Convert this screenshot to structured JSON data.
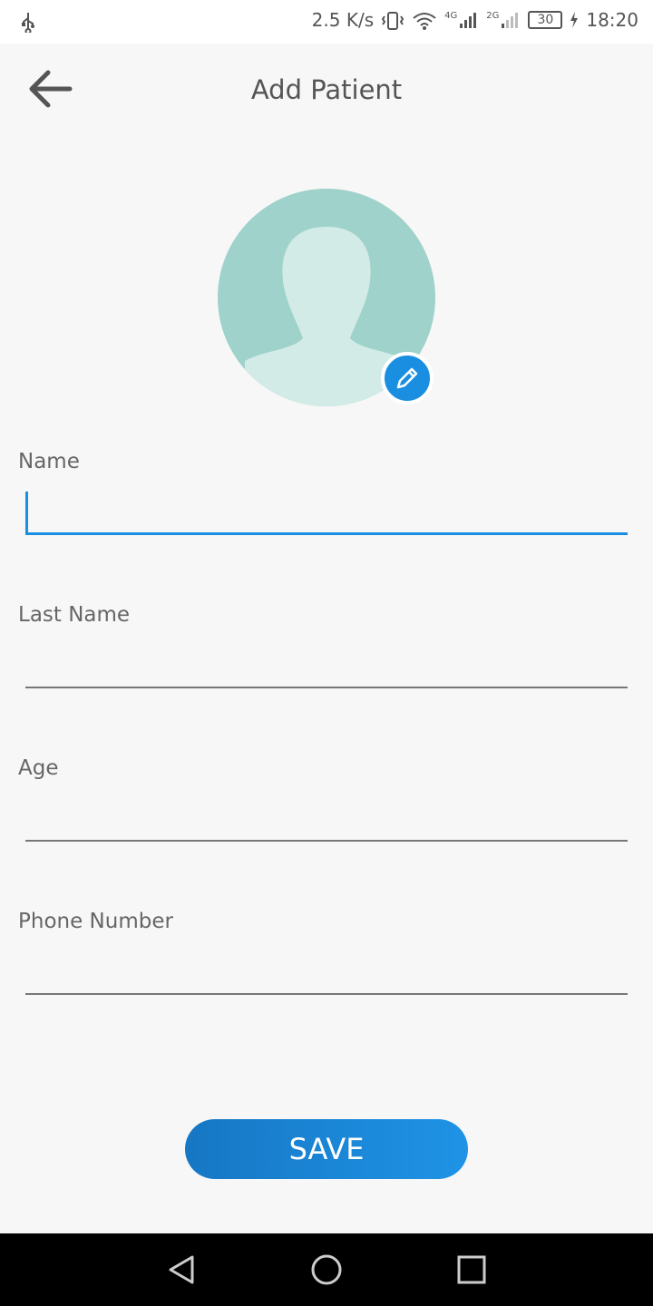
{
  "status_bar": {
    "usb_icon": "usb-icon",
    "net_speed": "2.5 K/s",
    "net_gen_1": "4G",
    "net_gen_2": "2G",
    "battery": "30",
    "time": "18:20"
  },
  "app_bar": {
    "title": "Add Patient",
    "back_icon": "arrow-left-icon"
  },
  "avatar": {
    "edit_icon": "pencil-icon",
    "placeholder_icon": "person-silhouette-icon"
  },
  "form": {
    "fields": [
      {
        "label": "Name",
        "value": "",
        "active": true
      },
      {
        "label": "Last Name",
        "value": ""
      },
      {
        "label": "Age",
        "value": ""
      },
      {
        "label": "Phone Number",
        "value": ""
      }
    ]
  },
  "save_label": "SAVE",
  "colors": {
    "accent": "#1a8ee1",
    "avatar_bg": "#9fd2ca",
    "avatar_fg": "#d3ebe7",
    "background": "#f7f7f7"
  },
  "nav_bar": {
    "back": "triangle-back-icon",
    "home": "circle-home-icon",
    "recents": "square-recents-icon"
  }
}
